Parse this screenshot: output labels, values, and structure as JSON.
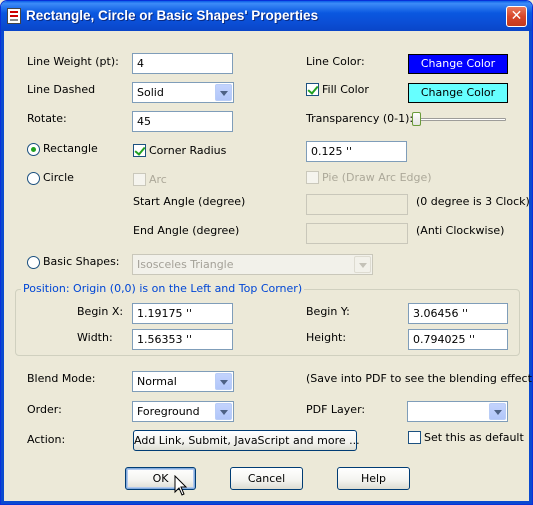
{
  "window": {
    "title": "Rectangle, Circle or Basic Shapes' Properties",
    "close_symbol": "✕"
  },
  "line_weight": {
    "label": "Line Weight (pt):",
    "value": "4"
  },
  "line_dashed": {
    "label": "Line Dashed",
    "value": "Solid"
  },
  "rotate": {
    "label": "Rotate:",
    "value": "45"
  },
  "line_color": {
    "label": "Line Color:",
    "button": "Change Color",
    "color": "#0000ff"
  },
  "fill_color": {
    "label": "Fill Color",
    "checked": true,
    "button": "Change Color",
    "color": "#66ffff"
  },
  "transparency": {
    "label": "Transparency (0-1):",
    "value": 0
  },
  "rectangle": {
    "label": "Rectangle",
    "selected": true
  },
  "corner_radius": {
    "label": "Corner Radius",
    "checked": true,
    "value": "0.125 ''"
  },
  "circle": {
    "label": "Circle",
    "selected": false
  },
  "arc": {
    "label": "Arc",
    "checked": false
  },
  "pie": {
    "label": "Pie (Draw Arc Edge)",
    "checked": false
  },
  "start_angle": {
    "label": "Start Angle (degree)",
    "value": "",
    "hint": "(0 degree is 3 Clock)"
  },
  "end_angle": {
    "label": "End Angle (degree)",
    "value": "",
    "hint": "(Anti Clockwise)"
  },
  "basic_shapes": {
    "label": "Basic Shapes:",
    "selected": false,
    "value": "Isosceles Triangle"
  },
  "position": {
    "legend": "Position: Origin (0,0) is on the Left and Top Corner)",
    "begin_x": {
      "label": "Begin X:",
      "value": "1.19175 ''"
    },
    "begin_y": {
      "label": "Begin Y:",
      "value": "3.06456 ''"
    },
    "width": {
      "label": "Width:",
      "value": "1.56353 ''"
    },
    "height": {
      "label": "Height:",
      "value": "0.794025 ''"
    }
  },
  "blend_mode": {
    "label": "Blend Mode:",
    "value": "Normal",
    "hint": "(Save into PDF to see the blending effect)"
  },
  "order": {
    "label": "Order:",
    "value": "Foreground"
  },
  "pdf_layer": {
    "label": "PDF Layer:",
    "value": ""
  },
  "action": {
    "label": "Action:",
    "button": "Add Link, Submit, JavaScript and more ..."
  },
  "set_default": {
    "label": "Set this as default",
    "checked": false
  },
  "buttons": {
    "ok": "OK",
    "cancel": "Cancel",
    "help": "Help"
  }
}
